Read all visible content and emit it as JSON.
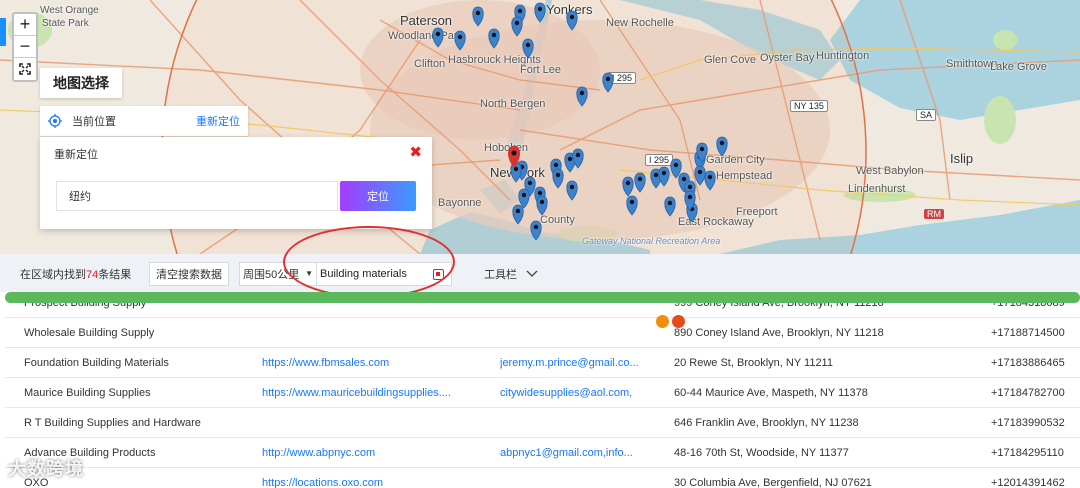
{
  "map": {
    "title": "地图选择",
    "current_location_label": "当前位置",
    "relocate_link": "重新定位",
    "relocate_panel_title": "重新定位",
    "location_input_value": "纽约",
    "locate_button": "定位",
    "zoom_in": "+",
    "zoom_out": "−",
    "place_labels": {
      "paterson": "Paterson",
      "yonkers": "Yonkers",
      "new_rochelle": "New Rochelle",
      "woodland_park": "Woodland Park",
      "hasbrouck": "Hasbrouck Heights",
      "clifton": "Clifton",
      "fort_lee": "Fort Lee",
      "glen_cove": "Glen Cove",
      "oyster_bay": "Oyster Bay",
      "huntington": "Huntington",
      "smithtown": "Smithtown",
      "lake_grove": "Lake Grove",
      "north_bergen": "North Bergen",
      "hoboken": "Hoboken",
      "new_york": "New York",
      "garden_city": "Garden City",
      "hempstead": "Hempstead",
      "west_babylon": "West Babylon",
      "islip": "Islip",
      "lindenhurst": "Lindenhurst",
      "freeport": "Freeport",
      "east_rockaway": "East Rockaway",
      "bayonne": "Bayonne",
      "gateway": "Gateway National Recreation Area",
      "west_orange": "West Orange",
      "state_park": "State Park",
      "county": "County"
    },
    "shields": {
      "i295": "I 295",
      "ny135": "NY 135",
      "sa": "SA",
      "rm": "RM"
    }
  },
  "toolbar": {
    "result_prefix": "在区域内找到",
    "result_count": "74",
    "result_suffix": "条结果",
    "clear_button": "清空搜索数据",
    "range_select": "周围50公里",
    "search_value": "Building materials",
    "tools_label": "工具栏"
  },
  "table": {
    "rows": [
      {
        "name": "Prospect Building Supply",
        "website": "",
        "email": "",
        "address": "999 Coney Island Ave, Brooklyn, NY 11218",
        "phone": "+17184318089"
      },
      {
        "name": "Wholesale Building Supply",
        "website": "",
        "email": "",
        "address": "890 Coney Island Ave, Brooklyn, NY 11218",
        "phone": "+17188714500"
      },
      {
        "name": "Foundation Building Materials",
        "website": "https://www.fbmsales.com",
        "email": "jeremy.m.prince@gmail.co...",
        "address": "20 Rewe St, Brooklyn, NY 11211",
        "phone": "+17183886465"
      },
      {
        "name": "Maurice Building Supplies",
        "website": "https://www.mauricebuildingsupplies....",
        "email": "citywidesupplies@aol.com,",
        "address": "60-44 Maurice Ave, Maspeth, NY 11378",
        "phone": "+17184782700"
      },
      {
        "name": "R T Building Supplies and Hardware",
        "website": "",
        "email": "",
        "address": "646 Franklin Ave, Brooklyn, NY 11238",
        "phone": "+17183990532"
      },
      {
        "name": "Advance Building Products",
        "website": "http://www.abpnyc.com",
        "email": "abpnyc1@gmail.com,info...",
        "address": "48-16 70th St, Woodside, NY 11377",
        "phone": "+17184295110"
      },
      {
        "name": "OXO",
        "website": "https://locations.oxo.com",
        "email": "",
        "address": "30 Columbia Ave, Bergenfield, NJ 07621",
        "phone": "+12014391462"
      }
    ]
  },
  "watermark": "大数跨境",
  "colors": {
    "accent_blue": "#1677ff",
    "count_red": "#e02020",
    "progress_green": "#5cb85c",
    "pin_blue": "#3d82cc",
    "pin_red": "#d93030"
  }
}
